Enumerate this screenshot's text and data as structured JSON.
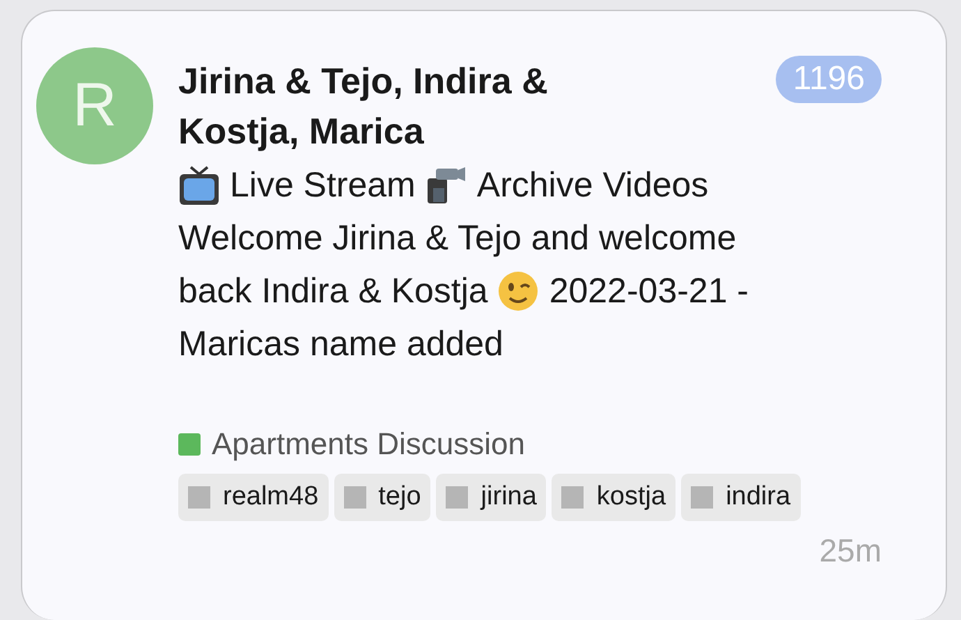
{
  "topic": {
    "avatar_letter": "R",
    "title": "Jirina & Tejo, Indira & Kostja, Marica",
    "count": "1196",
    "excerpt": [
      [
        {
          "kind": "tv"
        },
        {
          "kind": "text",
          "text": "Live Stream"
        },
        {
          "kind": "camera"
        },
        {
          "kind": "text",
          "text": "Archive Videos"
        }
      ],
      [
        {
          "kind": "text",
          "text": "Welcome Jirina & Tejo and welcome"
        }
      ],
      [
        {
          "kind": "text",
          "text": "back Indira & Kostja"
        },
        {
          "kind": "wink"
        },
        {
          "kind": "text",
          "text": "2022-03-21 -"
        }
      ],
      [
        {
          "kind": "text",
          "text": "Maricas name added"
        }
      ]
    ],
    "category": {
      "name": "Apartments Discussion",
      "color": "#5cb85c"
    },
    "tags": [
      "realm48",
      "tejo",
      "jirina",
      "kostja",
      "indira"
    ],
    "time": "25m"
  }
}
